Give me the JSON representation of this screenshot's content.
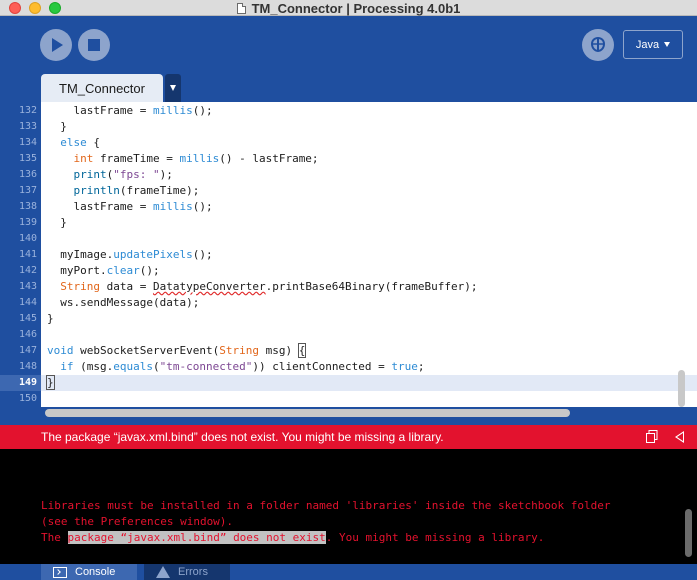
{
  "window": {
    "title": "TM_Connector | Processing 4.0b1"
  },
  "toolbar": {
    "run_icon": "play-icon",
    "stop_icon": "stop-icon",
    "debug_icon": "butterfly-icon",
    "mode_label": "Java"
  },
  "tabs": [
    {
      "label": "TM_Connector",
      "active": true
    }
  ],
  "editor": {
    "line_numbers": [
      "132",
      "133",
      "134",
      "135",
      "136",
      "137",
      "138",
      "139",
      "140",
      "141",
      "142",
      "143",
      "144",
      "145",
      "146",
      "147",
      "148",
      "149",
      "150"
    ],
    "current_line": "149"
  },
  "error_bar": {
    "message": "The package “javax.xml.bind” does not exist. You might be missing a library.",
    "background": "#e3122e"
  },
  "console": {
    "line1": "Libraries must be installed in a folder named 'libraries' inside the sketchbook folder",
    "line2": "(see the Preferences window).",
    "line3_prefix": "The ",
    "line3_highlight": "package “javax.xml.bind” does not exist",
    "line3_suffix": ". You might be missing a library."
  },
  "bottom_tabs": {
    "console_label": "Console",
    "errors_label": "Errors"
  },
  "colors": {
    "accent": "#1f4fa0",
    "error": "#e3122e"
  }
}
